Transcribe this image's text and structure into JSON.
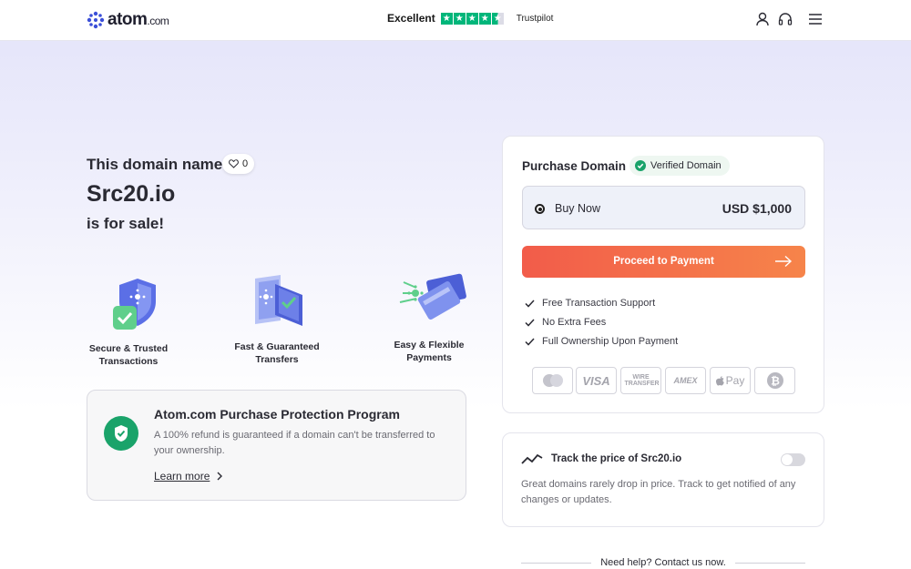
{
  "header": {
    "logo_text": "atom",
    "logo_suffix": ".com",
    "trustpilot_rating": "Excellent",
    "trustpilot_brand": "Trustpilot",
    "trustpilot_stars": 4.5,
    "icons": [
      "user-icon",
      "headset-icon",
      "menu-icon"
    ]
  },
  "hero": {
    "line1": "This domain name",
    "domain": "Src20.io",
    "line3": "is for sale!",
    "like_count": "0"
  },
  "features": [
    {
      "label_line1": "Secure & Trusted",
      "label_line2": "Transactions",
      "icon": "shield-check-icon"
    },
    {
      "label_line1": "Fast & Guaranteed",
      "label_line2": "Transfers",
      "icon": "transfer-cards-icon"
    },
    {
      "label_line1": "Easy & Flexible",
      "label_line2": "Payments",
      "icon": "payment-cards-icon"
    }
  ],
  "protection": {
    "title": "Atom.com Purchase Protection Program",
    "text": "A 100% refund is guaranteed if a domain can't be transferred to your ownership.",
    "link": "Learn more"
  },
  "purchase": {
    "title": "Purchase Domain",
    "badge": "Verified Domain",
    "option_label": "Buy Now",
    "option_price": "USD $1,000",
    "cta": "Proceed to Payment",
    "checks": [
      "Free Transaction Support",
      "No Extra Fees",
      "Full Ownership Upon Payment"
    ],
    "payment_methods": [
      "mastercard",
      "VISA",
      "WIRE TRANSFER",
      "AMEX",
      "Pay",
      "bitcoin"
    ]
  },
  "track": {
    "title": "Track the price of Src20.io",
    "text": "Great domains rarely drop in price. Track to get notified of any changes or updates.",
    "enabled": false
  },
  "footer": {
    "help": "Need help? Contact us now."
  },
  "colors": {
    "accent": "#f26b4a",
    "trustpilot": "#00b67a",
    "verified": "#1aa36a",
    "logo": "#3b4fd8"
  }
}
